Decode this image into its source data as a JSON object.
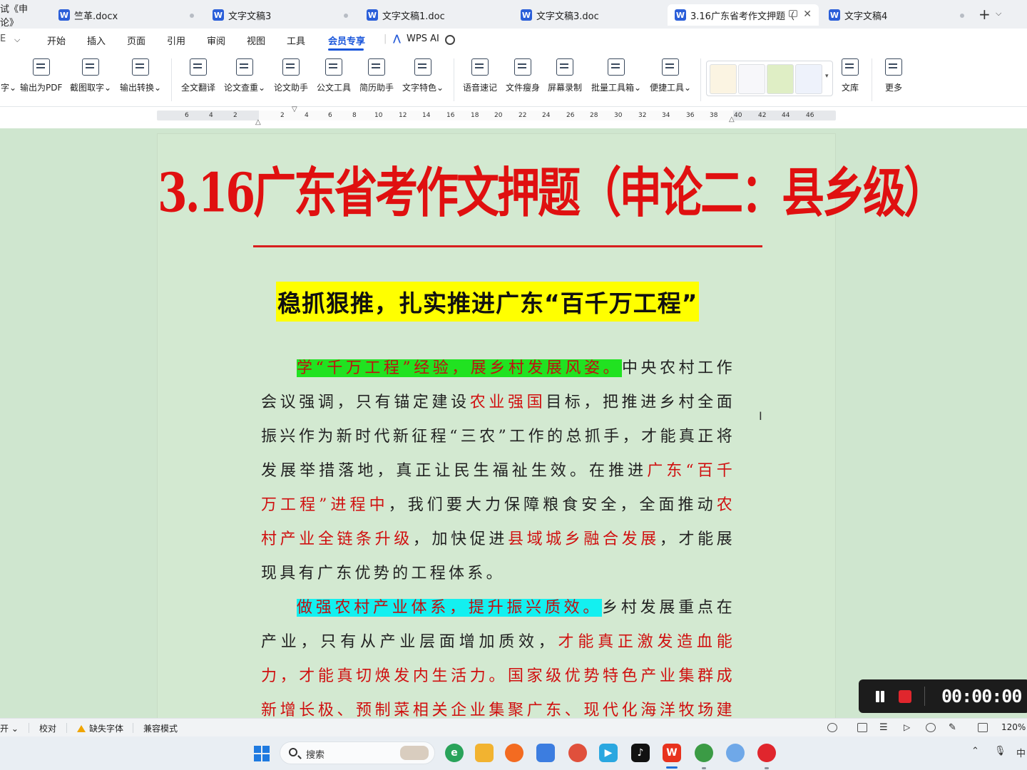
{
  "tabs": [
    {
      "label": "试《申论》",
      "partial": true
    },
    {
      "label": "竺革.docx"
    },
    {
      "label": "文字文稿3"
    },
    {
      "label": "文字文稿1.doc"
    },
    {
      "label": "文字文稿3.doc"
    },
    {
      "label": "3.16广东省考作文押题（",
      "active": true
    },
    {
      "label": "文字文稿4"
    }
  ],
  "tab_plus": "+",
  "tab_chevron": "⌄",
  "menu": {
    "left_partial": "E",
    "items": [
      "开始",
      "插入",
      "页面",
      "引用",
      "审阅",
      "视图",
      "工具",
      "会员专享"
    ],
    "active": "会员专享",
    "wps_ai": "WPS AI"
  },
  "ribbon": {
    "buttons": [
      {
        "label": "字",
        "icon": "text-icon"
      },
      {
        "label": "输出为PDF",
        "icon": "pdf-export-icon"
      },
      {
        "label": "截图取字",
        "icon": "screenshot-ocr-icon"
      },
      {
        "label": "输出转换",
        "icon": "convert-icon"
      },
      {
        "label": "全文翻译",
        "icon": "translate-icon"
      },
      {
        "label": "论文查重",
        "icon": "plagiarism-check-icon"
      },
      {
        "label": "论文助手",
        "icon": "paper-assistant-icon"
      },
      {
        "label": "公文工具",
        "icon": "official-doc-icon"
      },
      {
        "label": "简历助手",
        "icon": "resume-icon"
      },
      {
        "label": "文字特色",
        "icon": "text-feature-icon"
      },
      {
        "label": "语音速记",
        "icon": "voice-note-icon"
      },
      {
        "label": "文件瘦身",
        "icon": "file-slim-icon"
      },
      {
        "label": "屏幕录制",
        "icon": "screen-record-icon"
      },
      {
        "label": "批量工具箱",
        "icon": "batch-toolbox-icon"
      },
      {
        "label": "便捷工具",
        "icon": "quick-tools-icon"
      },
      {
        "label": "文库",
        "icon": "library-icon"
      },
      {
        "label": "更多",
        "icon": "more-grid-icon"
      }
    ]
  },
  "ruler": {
    "ticks_left": [
      "6",
      "4",
      "2"
    ],
    "ticks_right": [
      "2",
      "4",
      "6",
      "8",
      "10",
      "12",
      "14",
      "16",
      "18",
      "20",
      "22",
      "24",
      "26",
      "28",
      "30",
      "32",
      "34",
      "36",
      "38",
      "40",
      "42",
      "44",
      "46"
    ]
  },
  "document": {
    "title": "3.16广东省考作文押题（申论二：县乡级）",
    "subtitle": "稳抓狠推，扎实推进广东“百千万工程”",
    "p1": {
      "hl": "学“千万工程”经验，展乡村发展风姿。",
      "t1": "中央农村工作会议强调，只有锚定建设",
      "r1": "农业强国",
      "t2": "目标，把推进乡村全面振兴作为新时代新征程“三农”工作的总抓手，才能真正将发展举措落地，真正让民生福祉生效。在推进",
      "r2": "广东“百千万工程”进程中",
      "t3": "，我们要大力保障粮食安全，全面推动",
      "r3": "农村产业全链条升级",
      "t4": "，加快促进",
      "r4": "县域城乡融合发展",
      "t5": "，才能展现具有广东优势的工程体系。"
    },
    "p2": {
      "hl": "做强农村产业体系，提升振兴质效。",
      "t1": "乡村发展重点在产业，只有从产业层面增加质效，",
      "r1": "才能真正激发造血能力，才能真切焕发内生活力。国家级优势特色产业集群成新增长极、预制菜相关企业集聚广东、现代化海洋牧场建设稳健起"
    }
  },
  "recorder": {
    "time": "00:00:00"
  },
  "status": {
    "left_partial": "开",
    "proofread": "校对",
    "missing_font": "缺失字体",
    "compat": "兼容模式",
    "zoom": "120%"
  },
  "taskbar": {
    "search_placeholder": "搜索",
    "ime": "中"
  }
}
